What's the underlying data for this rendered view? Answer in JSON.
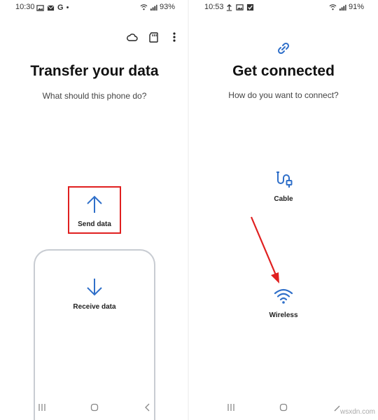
{
  "left": {
    "status": {
      "time": "10:30",
      "battery": "93%",
      "notif_letter": "G",
      "notif_dot": "•"
    },
    "title": "Transfer your data",
    "subtitle": "What should this phone do?",
    "options": [
      {
        "label": "Send data",
        "icon": "arrow-up-icon",
        "highlighted": true
      },
      {
        "label": "Receive data",
        "icon": "arrow-down-icon",
        "highlighted": false
      }
    ],
    "toolbar_icons": [
      "cloud-icon",
      "sd-card-icon",
      "more-vert-icon"
    ]
  },
  "right": {
    "status": {
      "time": "10:53",
      "battery": "91%"
    },
    "title": "Get connected",
    "subtitle": "How do you want to connect?",
    "options": [
      {
        "label": "Cable",
        "icon": "cable-icon"
      },
      {
        "label": "Wireless",
        "icon": "wifi-icon"
      }
    ]
  },
  "colors": {
    "accent": "#2f6fc9",
    "highlight": "#e02020",
    "annotation_arrow": "#e02020"
  },
  "watermark": "wsxdn.com"
}
